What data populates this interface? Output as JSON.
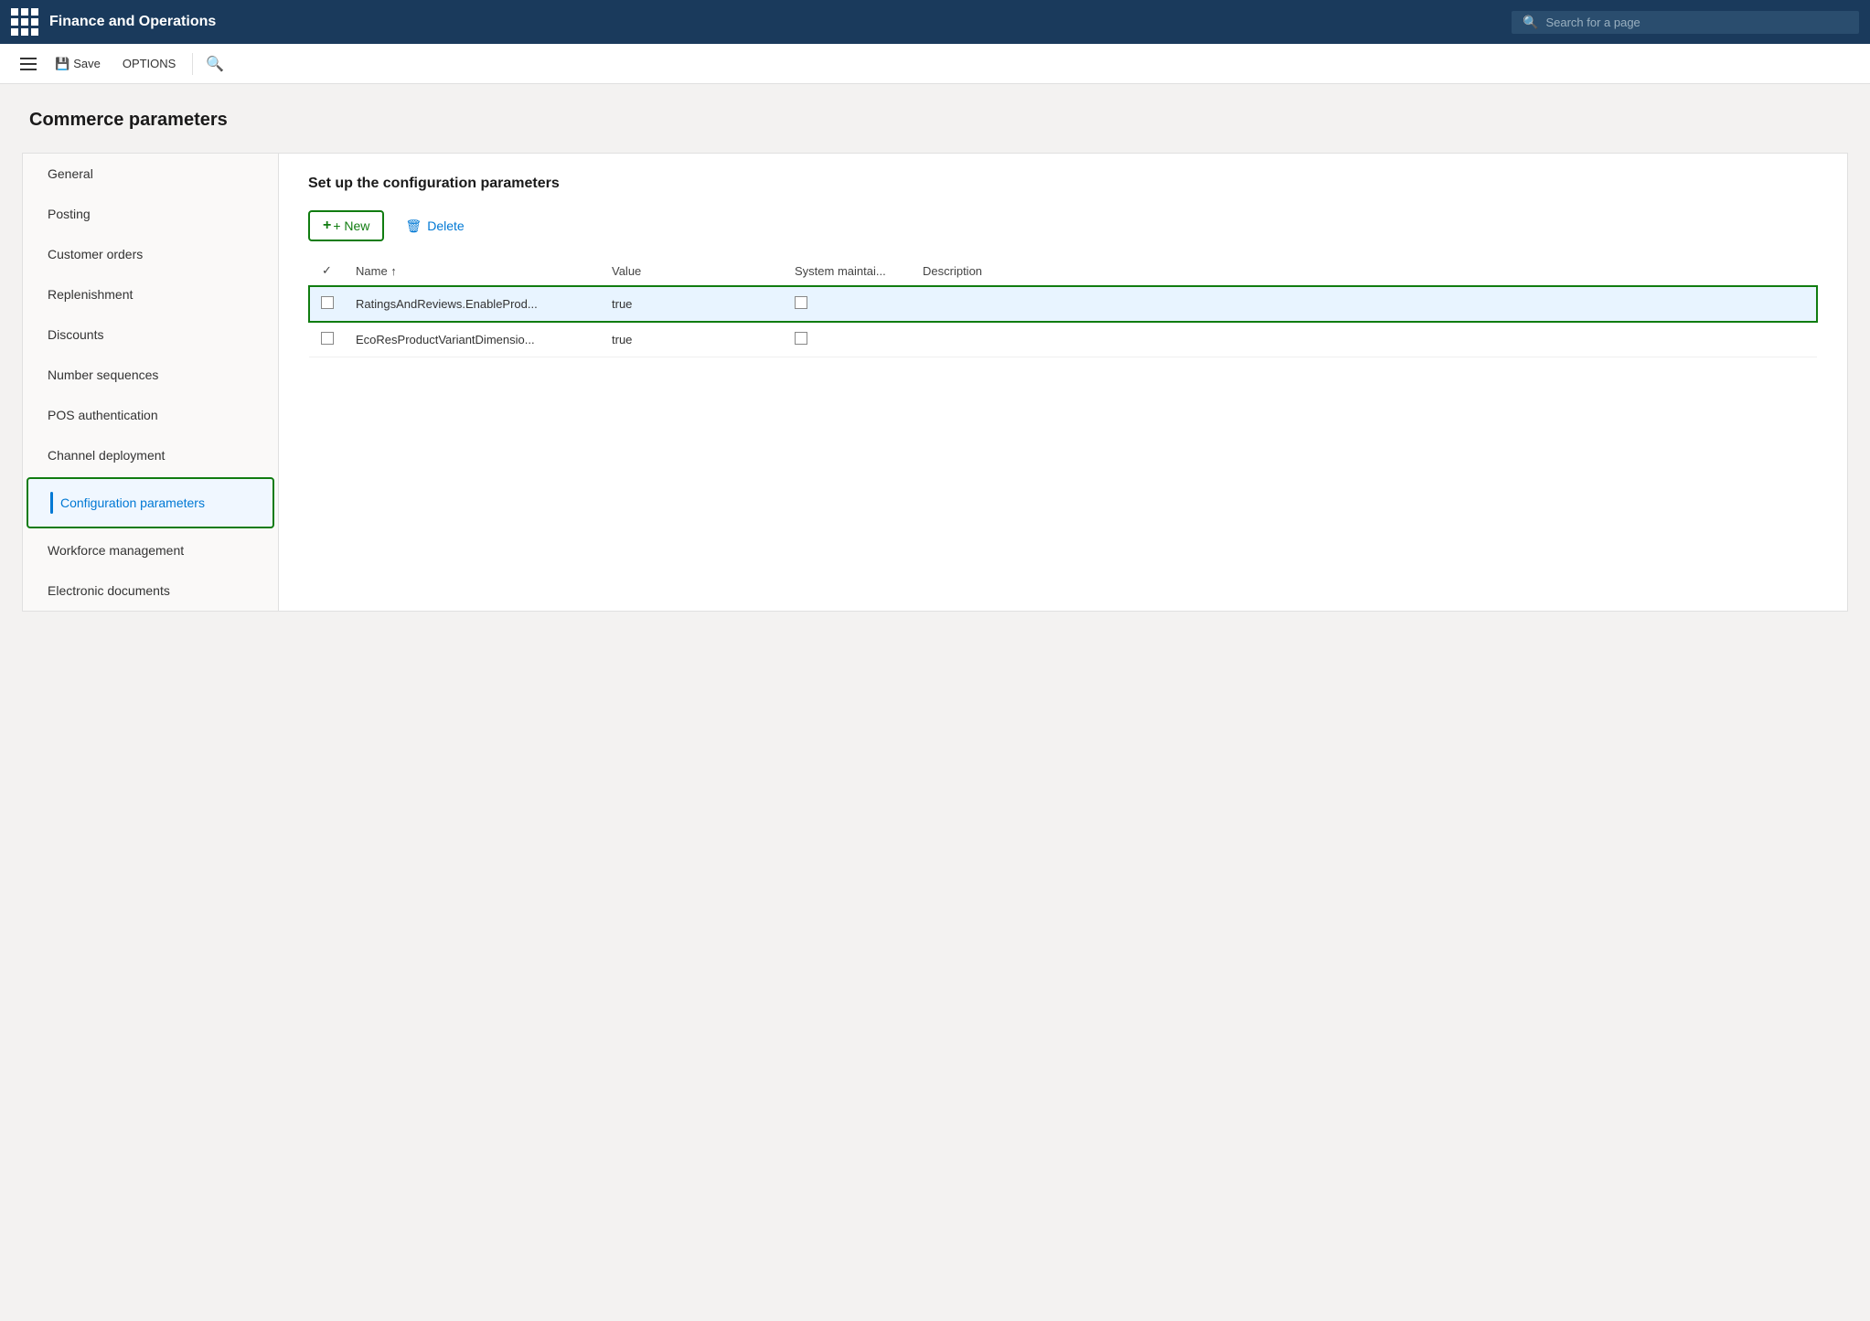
{
  "app": {
    "title": "Finance and Operations",
    "search_placeholder": "Search for a page"
  },
  "toolbar": {
    "save_label": "Save",
    "options_label": "OPTIONS"
  },
  "page": {
    "title": "Commerce parameters"
  },
  "sidebar": {
    "items": [
      {
        "id": "general",
        "label": "General",
        "active": false
      },
      {
        "id": "posting",
        "label": "Posting",
        "active": false
      },
      {
        "id": "customer-orders",
        "label": "Customer orders",
        "active": false
      },
      {
        "id": "replenishment",
        "label": "Replenishment",
        "active": false
      },
      {
        "id": "discounts",
        "label": "Discounts",
        "active": false
      },
      {
        "id": "number-sequences",
        "label": "Number sequences",
        "active": false
      },
      {
        "id": "pos-authentication",
        "label": "POS authentication",
        "active": false
      },
      {
        "id": "channel-deployment",
        "label": "Channel deployment",
        "active": false
      },
      {
        "id": "configuration-parameters",
        "label": "Configuration parameters",
        "active": true
      },
      {
        "id": "workforce-management",
        "label": "Workforce management",
        "active": false
      },
      {
        "id": "electronic-documents",
        "label": "Electronic documents",
        "active": false
      }
    ]
  },
  "content": {
    "section_title": "Set up the configuration parameters",
    "btn_new": "+ New",
    "btn_delete": "Delete",
    "table": {
      "columns": [
        {
          "id": "check",
          "label": ""
        },
        {
          "id": "name",
          "label": "Name ↑"
        },
        {
          "id": "value",
          "label": "Value"
        },
        {
          "id": "system",
          "label": "System maintai..."
        },
        {
          "id": "description",
          "label": "Description"
        }
      ],
      "rows": [
        {
          "selected": true,
          "name": "RatingsAndReviews.EnableProd...",
          "value": "true",
          "system_maintained": false,
          "description": ""
        },
        {
          "selected": false,
          "name": "EcoResProductVariantDimensio...",
          "value": "true",
          "system_maintained": false,
          "description": ""
        }
      ]
    }
  }
}
